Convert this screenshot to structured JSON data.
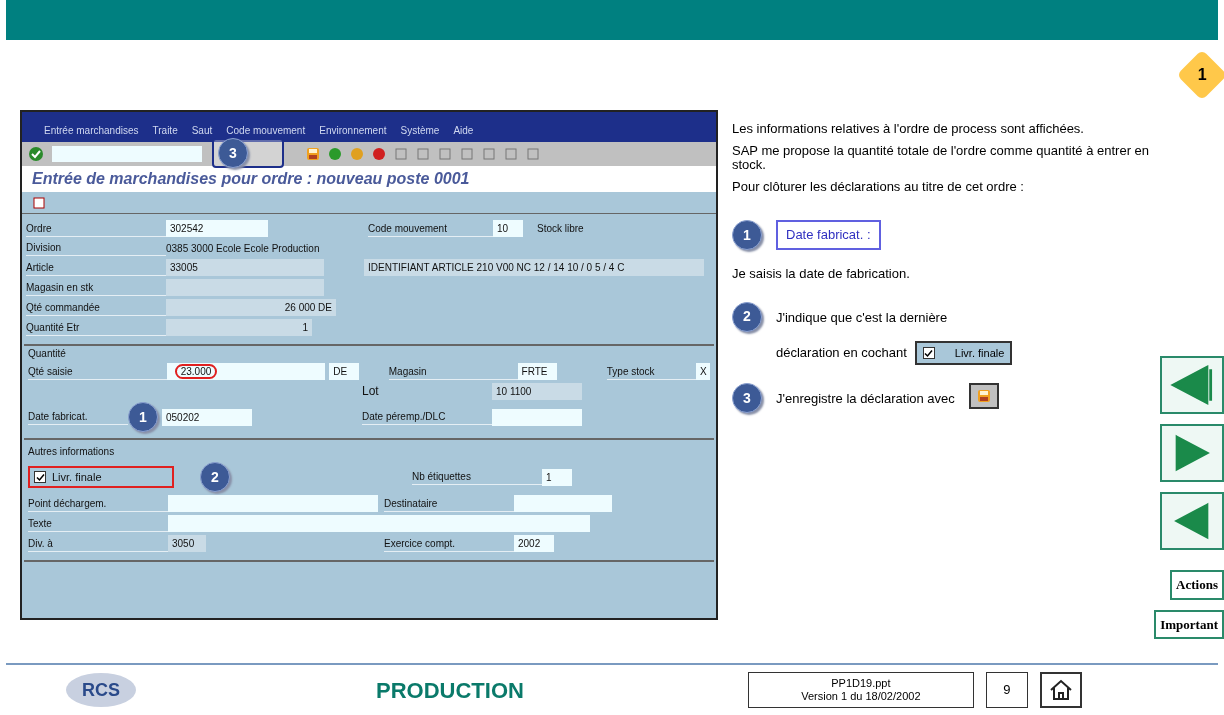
{
  "step_badge": "1",
  "sap": {
    "menu": [
      "Entrée marchandises",
      "Traite",
      "Saut",
      "Code mouvement",
      "Environnement",
      "Système",
      "Aide"
    ],
    "save_callout": "3",
    "title": "Entrée de marchandises pour ordre : nouveau poste 0001",
    "header_fields": [
      {
        "label": "Ordre",
        "value": "302542",
        "extra_label": "Code mouvement",
        "extra_value": "10",
        "extra_text": "Stock libre"
      },
      {
        "label": "Division",
        "text": "0385 3000 Ecole Ecole Production"
      },
      {
        "label": "Article",
        "value": "33005",
        "extra_value": "IDENTIFIANT ARTICLE 210 V00 NC 12 / 14 10 / 0 5 / 4 C"
      },
      {
        "label": "Magasin en stk"
      },
      {
        "label": "Qté commandée",
        "value": "26 000 DE"
      },
      {
        "label": "Quantité Etr",
        "value": "1"
      }
    ],
    "quantity_group": {
      "title": "Quantité",
      "qty_label": "Qté saisie",
      "qty_value": "23.000",
      "qty_unit": "DE",
      "store_label": "Magasin",
      "store_value": "FRTE",
      "type_label": "Type stock",
      "type_value": "X",
      "lot_label": "Lot",
      "lot_value": "10 1100",
      "date_label": "Date fabricat.",
      "date_value": "050202",
      "date_callout": "1",
      "exp_label": "Date péremp./DLC"
    },
    "other_group": {
      "title": "Autres informations",
      "final": {
        "label": "Livr. finale",
        "checked": true
      },
      "final_callout": "2",
      "labels_label": "Nb étiquettes",
      "labels_value": "1",
      "unload_label": "Point déchargem.",
      "receiver_label": "Destinataire",
      "text_label": "Texte",
      "div_label": "Div. à ",
      "div_value": "3050",
      "year_label": "Exercice compt.",
      "year_value": "2002"
    }
  },
  "explanation": {
    "paragraphs": [
      "Les informations relatives à l'ordre de process sont affichées.",
      "SAP me propose la quantité totale de l'ordre comme quantité à entrer en stock.",
      "Pour clôturer les déclarations au titre de cet ordre :"
    ],
    "steps": [
      {
        "number": "1",
        "kind": "field",
        "chip": "Date fabricat. :",
        "after": "Je saisis la date de fabrication."
      },
      {
        "number": "2",
        "kind": "checkbox",
        "lines": [
          "J'indique que c'est la dernière",
          "déclaration en cochant"
        ],
        "chip": "Livr. finale",
        "checked": true
      },
      {
        "number": "3",
        "kind": "save",
        "lines": [
          "J'enregistre la déclaration avec"
        ]
      }
    ]
  },
  "nav": {
    "actions": "Actions",
    "important": "Important"
  },
  "footer": {
    "logo": "RCS",
    "title": "PRODUCTION",
    "file": "PP1D19.ppt",
    "version": "Version 1 du 18/02/2002",
    "page": "9"
  }
}
